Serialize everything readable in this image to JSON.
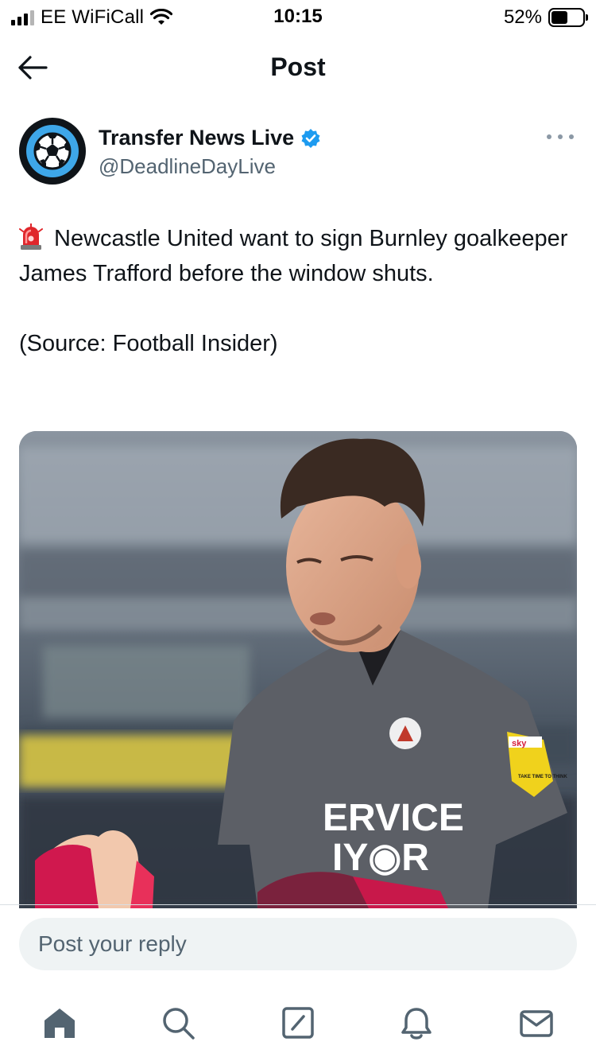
{
  "status_bar": {
    "carrier": "EE WiFiCall",
    "time": "10:15",
    "battery_percent_label": "52%",
    "battery_level": 0.52
  },
  "header": {
    "title": "Post",
    "back_icon": "arrow-left-icon"
  },
  "author": {
    "name": "Transfer News Live",
    "handle": "@DeadlineDayLive",
    "verified": true,
    "avatar_icon": "soccer-ball-icon"
  },
  "tweet": {
    "emoji_icon": "police-siren-icon",
    "text": "Newcastle United want to sign Burnley goalkeeper James Trafford before the window shuts.",
    "source": "(Source: Football Insider)"
  },
  "media": {
    "shirt_text_line1": "ERVICE",
    "shirt_text_line2": "IY◉R",
    "badge_brand": "sky",
    "badge_text": "TAKE TIME TO THINK"
  },
  "reply": {
    "placeholder": "Post your reply"
  },
  "tabs": [
    {
      "icon": "home-icon",
      "active": true
    },
    {
      "icon": "search-icon",
      "active": false
    },
    {
      "icon": "compose-icon",
      "active": false
    },
    {
      "icon": "bell-icon",
      "active": false
    },
    {
      "icon": "mail-icon",
      "active": false
    }
  ],
  "colors": {
    "text_primary": "#0f1419",
    "text_secondary": "#536471",
    "verified_blue": "#1d9bf0",
    "reply_bg": "#eff3f4",
    "tab_icon": "#536471"
  }
}
